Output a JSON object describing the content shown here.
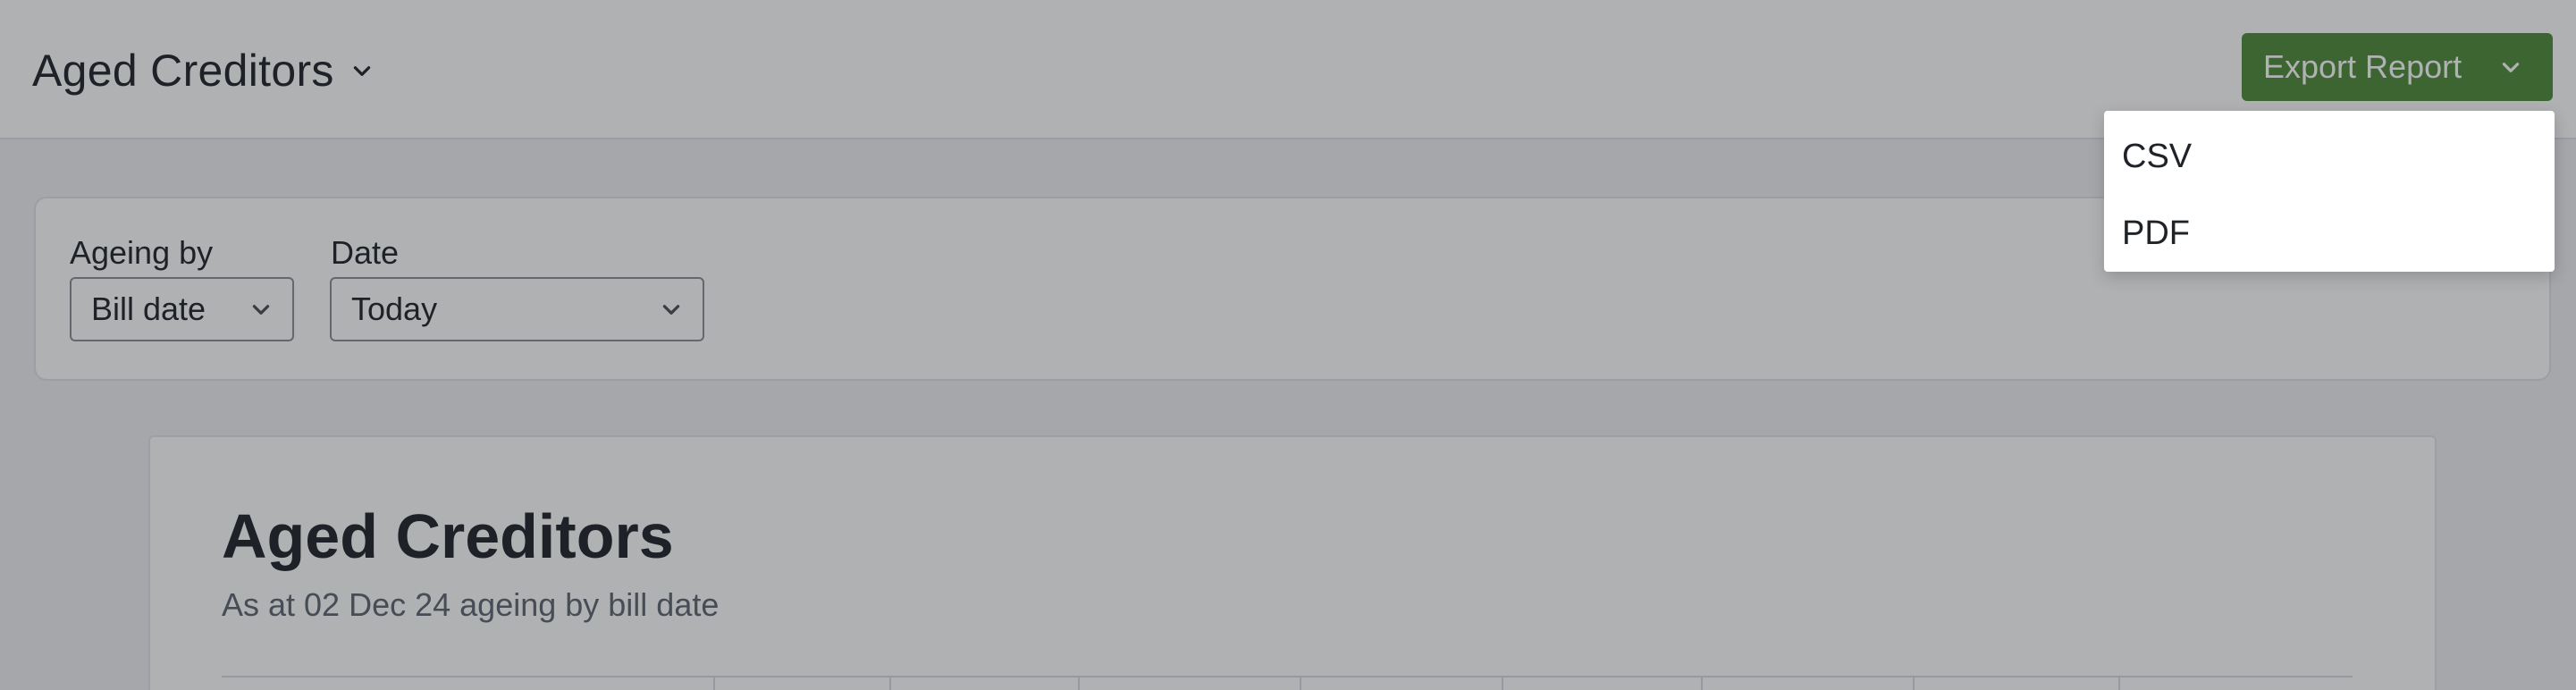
{
  "header": {
    "title": "Aged Creditors",
    "export_label": "Export Report"
  },
  "filters": {
    "ageing_label": "Ageing by",
    "ageing_value": "Bill date",
    "date_label": "Date",
    "date_value": "Today"
  },
  "report": {
    "title": "Aged Creditors",
    "subtitle": "As at 02 Dec 24 ageing by bill date"
  },
  "export_menu": {
    "items": [
      {
        "label": "CSV"
      },
      {
        "label": "PDF"
      }
    ]
  },
  "colors": {
    "accent": "#4d8a38",
    "overlay": "#1e2024"
  },
  "icons": {
    "title_chevron": "chevron-down-icon",
    "export_chevron": "chevron-down-icon",
    "select_chevron": "chevron-down-icon"
  }
}
